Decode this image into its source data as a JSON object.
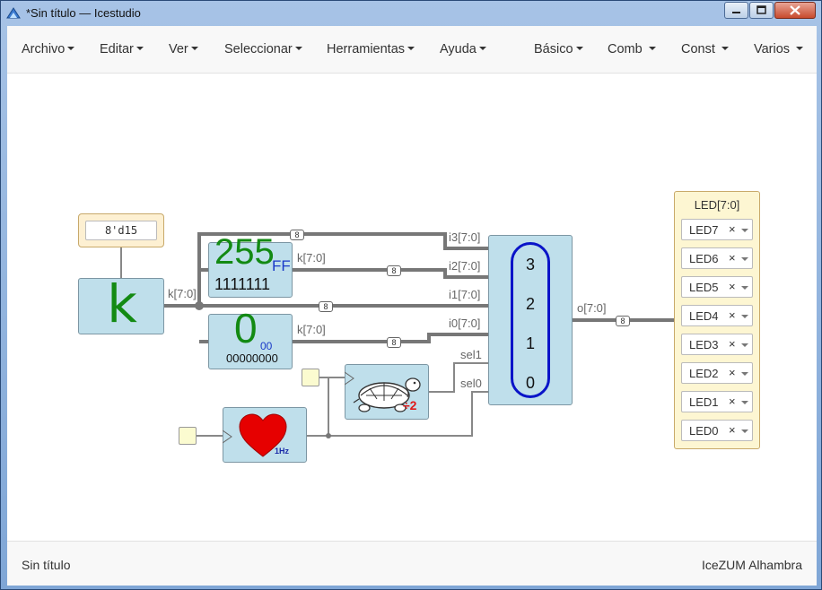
{
  "window": {
    "title": "*Sin título — Icestudio"
  },
  "menu": {
    "left": [
      "Archivo",
      "Editar",
      "Ver",
      "Seleccionar",
      "Herramientas",
      "Ayuda"
    ],
    "right": [
      "Básico",
      "Comb",
      "Const",
      "Varios"
    ]
  },
  "footer": {
    "left": "Sin título",
    "right": "IceZUM Alhambra"
  },
  "circuit": {
    "constant": {
      "value": "8'd15",
      "letter": "k",
      "out_label": "k[7:0]"
    },
    "display_255": {
      "big": "255",
      "hex": "FF",
      "bits": "1111111",
      "in_label": "k[7:0]"
    },
    "display_0": {
      "big": "0",
      "hex": "00",
      "bits": "00000000",
      "in_label": "k[7:0]"
    },
    "mux": {
      "items": [
        "3",
        "2",
        "1",
        "0"
      ],
      "inputs": [
        "i3[7:0]",
        "i2[7:0]",
        "i1[7:0]",
        "i0[7:0]"
      ],
      "sel": [
        "sel1",
        "sel0"
      ],
      "out_label": "o[7:0]"
    },
    "bus_width": "8",
    "prescaler": {
      "factor": "÷2"
    },
    "clock": {
      "freq": "1Hz"
    },
    "led_panel": {
      "title": "LED[7:0]",
      "leds": [
        "LED7",
        "LED6",
        "LED5",
        "LED4",
        "LED3",
        "LED2",
        "LED1",
        "LED0"
      ],
      "remove_glyph": "×"
    }
  }
}
